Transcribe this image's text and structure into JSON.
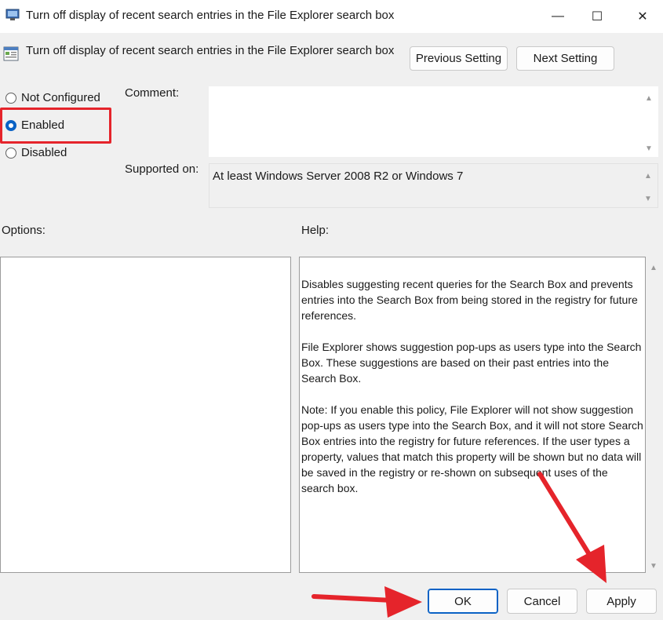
{
  "window": {
    "title": "Turn off display of recent search entries in the File Explorer search box",
    "minimize_glyph": "—",
    "maximize_glyph": "☐",
    "close_glyph": "✕",
    "app_icon": "group-policy-icon"
  },
  "header": {
    "policy_name": "Turn off display of recent search entries in the File Explorer search box",
    "policy_icon": "policy-setting-icon",
    "previous_label": "Previous Setting",
    "next_label": "Next Setting"
  },
  "state": {
    "options": [
      {
        "label": "Not Configured",
        "selected": false
      },
      {
        "label": "Enabled",
        "selected": true
      },
      {
        "label": "Disabled",
        "selected": false
      }
    ]
  },
  "comment": {
    "label": "Comment:",
    "value": ""
  },
  "supported": {
    "label": "Supported on:",
    "value": "At least Windows Server 2008 R2 or Windows 7"
  },
  "options_section": {
    "label": "Options:"
  },
  "help_section": {
    "label": "Help:",
    "paragraphs": [
      "Disables suggesting recent queries for the Search Box and prevents entries into the Search Box from being stored in the registry for future references.",
      "File Explorer shows suggestion pop-ups as users type into the Search Box.  These suggestions are based on their past entries into the Search Box.",
      "Note: If you enable this policy, File Explorer will not show suggestion pop-ups as users type into the Search Box, and it will not store Search Box entries into the registry for future references.  If the user types a property, values that match this property will be shown but no data will be saved in the registry or re-shown on subsequent uses of the search box."
    ]
  },
  "footer": {
    "ok_label": "OK",
    "cancel_label": "Cancel",
    "apply_label": "Apply"
  },
  "colors": {
    "accent": "#0a62c5",
    "annotation_red": "#e5242b"
  }
}
